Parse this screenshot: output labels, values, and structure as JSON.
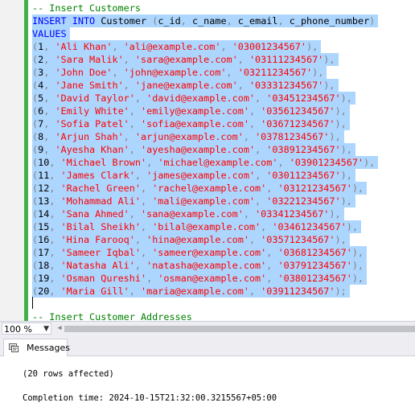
{
  "editor": {
    "lines": [
      {
        "type": "comment",
        "text": "-- Insert Customers"
      },
      {
        "type": "insert",
        "kw1": "INSERT",
        "kw2": "INTO",
        "table": "Customer",
        "cols": [
          "c_id",
          "c_name",
          "c_email",
          "c_phone_number"
        ]
      },
      {
        "type": "values",
        "text": "VALUES"
      },
      {
        "type": "row",
        "id": "1",
        "name": "'Ali Khan'",
        "email": "'ali@example.com'",
        "phone": "'03001234567'",
        "end": "),"
      },
      {
        "type": "row",
        "id": "2",
        "name": "'Sara Malik'",
        "email": "'sara@example.com'",
        "phone": "'03111234567'",
        "end": "),"
      },
      {
        "type": "row",
        "id": "3",
        "name": "'John Doe'",
        "email": "'john@example.com'",
        "phone": "'03211234567'",
        "end": "),"
      },
      {
        "type": "row",
        "id": "4",
        "name": "'Jane Smith'",
        "email": "'jane@example.com'",
        "phone": "'03331234567'",
        "end": "),"
      },
      {
        "type": "row",
        "id": "5",
        "name": "'David Taylor'",
        "email": "'david@example.com'",
        "phone": "'03451234567'",
        "end": "),"
      },
      {
        "type": "row",
        "id": "6",
        "name": "'Emily White'",
        "email": "'emily@example.com'",
        "phone": "'03561234567'",
        "end": "),"
      },
      {
        "type": "row",
        "id": "7",
        "name": "'Sofia Patel'",
        "email": "'sofia@example.com'",
        "phone": "'03671234567'",
        "end": "),"
      },
      {
        "type": "row",
        "id": "8",
        "name": "'Arjun Shah'",
        "email": "'arjun@example.com'",
        "phone": "'03781234567'",
        "end": "),"
      },
      {
        "type": "row",
        "id": "9",
        "name": "'Ayesha Khan'",
        "email": "'ayesha@example.com'",
        "phone": "'03891234567'",
        "end": "),"
      },
      {
        "type": "row",
        "id": "10",
        "name": "'Michael Brown'",
        "email": "'michael@example.com'",
        "phone": "'03901234567'",
        "end": "),"
      },
      {
        "type": "row",
        "id": "11",
        "name": "'James Clark'",
        "email": "'james@example.com'",
        "phone": "'03011234567'",
        "end": "),"
      },
      {
        "type": "row",
        "id": "12",
        "name": "'Rachel Green'",
        "email": "'rachel@example.com'",
        "phone": "'03121234567'",
        "end": "),"
      },
      {
        "type": "row",
        "id": "13",
        "name": "'Mohammad Ali'",
        "email": "'mali@example.com'",
        "phone": "'03221234567'",
        "end": "),"
      },
      {
        "type": "row",
        "id": "14",
        "name": "'Sana Ahmed'",
        "email": "'sana@example.com'",
        "phone": "'03341234567'",
        "end": "),"
      },
      {
        "type": "row",
        "id": "15",
        "name": "'Bilal Sheikh'",
        "email": "'bilal@example.com'",
        "phone": "'03461234567'",
        "end": "),"
      },
      {
        "type": "row",
        "id": "16",
        "name": "'Hina Farooq'",
        "email": "'hina@example.com'",
        "phone": "'03571234567'",
        "end": "),"
      },
      {
        "type": "row",
        "id": "17",
        "name": "'Sameer Iqbal'",
        "email": "'sameer@example.com'",
        "phone": "'03681234567'",
        "end": "),"
      },
      {
        "type": "row",
        "id": "18",
        "name": "'Natasha Ali'",
        "email": "'natasha@example.com'",
        "phone": "'03791234567'",
        "end": "),"
      },
      {
        "type": "row",
        "id": "19",
        "name": "'Osman Qureshi'",
        "email": "'osman@example.com'",
        "phone": "'03801234567'",
        "end": "),"
      },
      {
        "type": "row",
        "id": "20",
        "name": "'Maria Gill'",
        "email": "'maria@example.com'",
        "phone": "'03911234567'",
        "end": ");"
      },
      {
        "type": "blank",
        "text": ""
      },
      {
        "type": "comment",
        "text": "-- Insert Customer Addresses"
      }
    ]
  },
  "statusbar": {
    "zoom": "100 %"
  },
  "results_tabs": {
    "messages_label": "Messages"
  },
  "messages": {
    "rows_affected": "(20 rows affected)",
    "completion": "Completion time: 2024-10-15T21:32:00.3215567+05:00"
  },
  "colors": {
    "keyword": "#0000ff",
    "string": "#ff0000",
    "comment": "#008000",
    "punctuation": "#808080",
    "selection": "#add6ff",
    "change_bar": "#43b047"
  }
}
